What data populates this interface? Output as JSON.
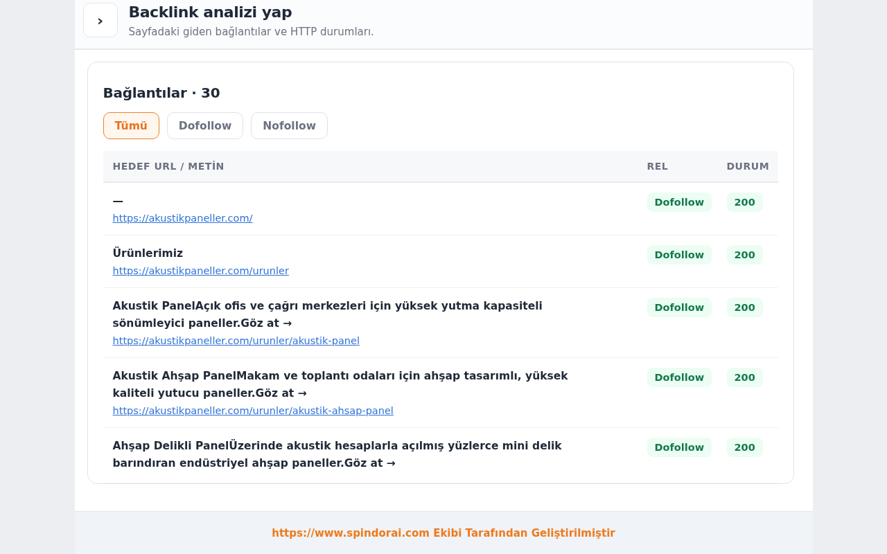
{
  "header": {
    "button": "›",
    "title": "Backlink analizi yap",
    "subtitle": "Sayfadaki giden bağlantılar ve HTTP durumları."
  },
  "card": {
    "title": "Bağlantılar · 30",
    "filters": [
      {
        "label": "Tümü",
        "selected": true
      },
      {
        "label": "Dofollow",
        "selected": false
      },
      {
        "label": "Nofollow",
        "selected": false
      }
    ],
    "table": {
      "columns": [
        "HEDEF URL / METİN",
        "REL",
        "DURUM"
      ],
      "rows": [
        {
          "text": "—",
          "url": "https://akustikpaneller.com/",
          "rel": "Dofollow",
          "status": "200"
        },
        {
          "text": "Ürünlerimiz",
          "url": "https://akustikpaneller.com/urunler",
          "rel": "Dofollow",
          "status": "200"
        },
        {
          "text": "Akustik PanelAçık ofis ve çağrı merkezleri için yüksek yutma kapasiteli sönümleyici paneller.Göz at →",
          "url": "https://akustikpaneller.com/urunler/akustik-panel",
          "rel": "Dofollow",
          "status": "200"
        },
        {
          "text": "Akustik Ahşap PanelMakam ve toplantı odaları için ahşap tasarımlı, yüksek kaliteli yutucu paneller.Göz at →",
          "url": "https://akustikpaneller.com/urunler/akustik-ahsap-panel",
          "rel": "Dofollow",
          "status": "200"
        },
        {
          "text": "Ahşap Delikli PanelÜzerinde akustik hesaplarla açılmış yüzlerce mini delik barındıran endüstriyel ahşap paneller.Göz at →",
          "rel": "Dofollow",
          "status": "200"
        }
      ]
    }
  },
  "footer": "https://www.spindorai.com Ekibi Tarafından Geliştirilmiştir"
}
